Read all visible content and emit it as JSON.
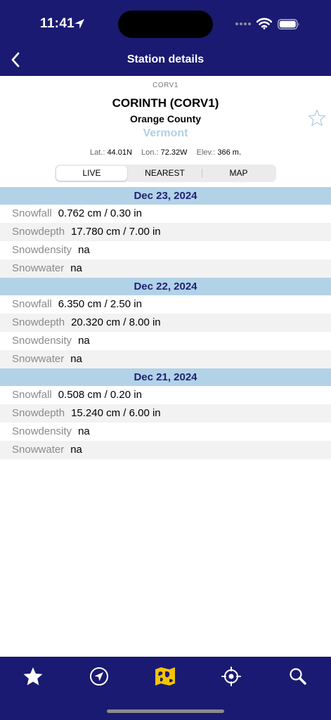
{
  "status": {
    "time": "11:41"
  },
  "nav": {
    "title": "Station details"
  },
  "station": {
    "code": "CORV1",
    "name": "CORINTH (CORV1)",
    "county": "Orange County",
    "state": "Vermont",
    "lat_label": "Lat.:",
    "lat": "44.01N",
    "lon_label": "Lon.:",
    "lon": "72.32W",
    "elev_label": "Elev.:",
    "elev": "366 m."
  },
  "segments": {
    "live": "LIVE",
    "nearest": "NEAREST",
    "map": "MAP",
    "selected": "LIVE"
  },
  "days": [
    {
      "date": "Dec 23, 2024",
      "rows": [
        {
          "label": "Snowfall",
          "value": "0.762 cm / 0.30 in"
        },
        {
          "label": "Snowdepth",
          "value": "17.780 cm / 7.00 in"
        },
        {
          "label": "Snowdensity",
          "value": "na"
        },
        {
          "label": "Snowwater",
          "value": "na"
        }
      ]
    },
    {
      "date": "Dec 22, 2024",
      "rows": [
        {
          "label": "Snowfall",
          "value": "6.350 cm / 2.50 in"
        },
        {
          "label": "Snowdepth",
          "value": "20.320 cm / 8.00 in"
        },
        {
          "label": "Snowdensity",
          "value": "na"
        },
        {
          "label": "Snowwater",
          "value": "na"
        }
      ]
    },
    {
      "date": "Dec 21, 2024",
      "rows": [
        {
          "label": "Snowfall",
          "value": "0.508 cm / 0.20 in"
        },
        {
          "label": "Snowdepth",
          "value": "15.240 cm / 6.00 in"
        },
        {
          "label": "Snowdensity",
          "value": "na"
        },
        {
          "label": "Snowwater",
          "value": "na"
        }
      ]
    }
  ],
  "tabbar": {
    "items": [
      "star-icon",
      "compass-icon",
      "map-icon",
      "crosshair-icon",
      "search-icon"
    ],
    "active": "map-icon"
  },
  "colors": {
    "bar": "#1a1a72",
    "header": "#b2d2e8",
    "header_text": "#1f2270",
    "state": "#b2d0e6",
    "active_tab": "#f5c400"
  }
}
